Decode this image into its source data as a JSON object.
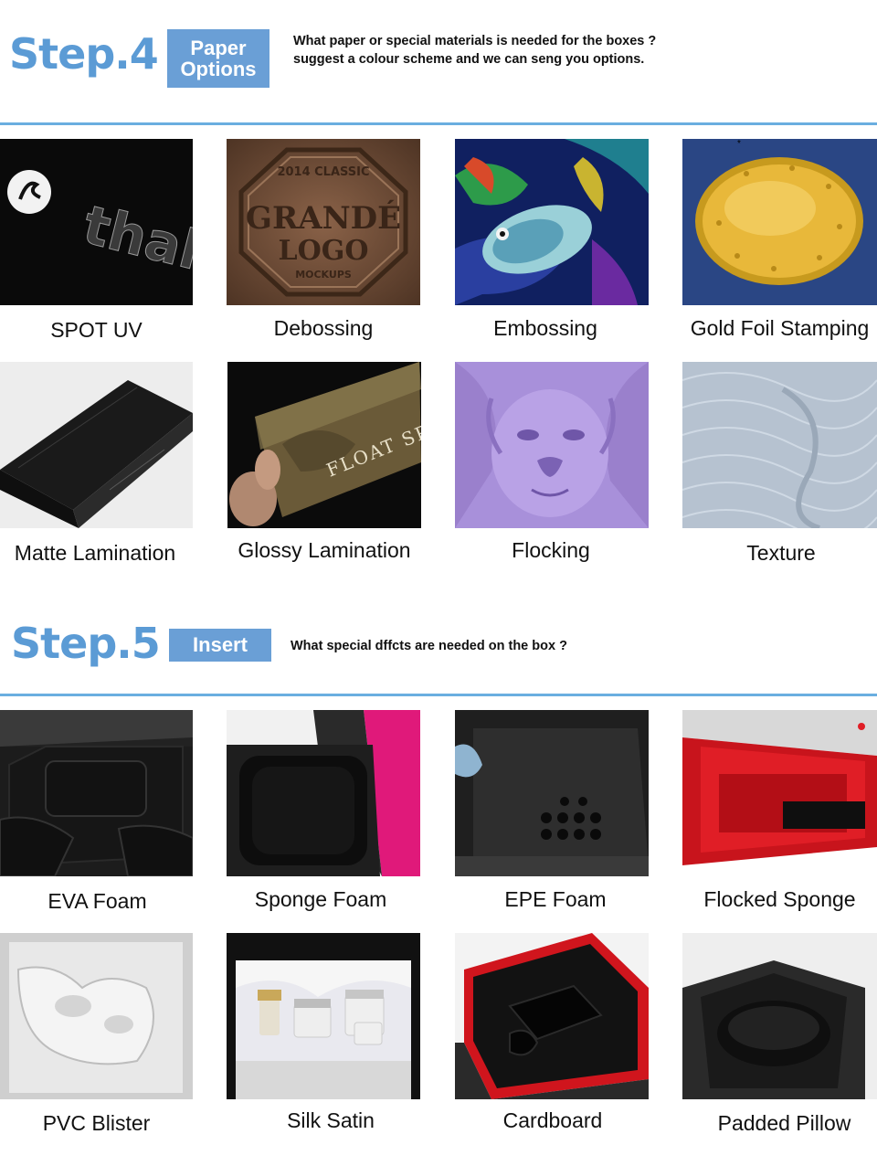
{
  "step4": {
    "title": "Step.4",
    "badge_line1": "Paper",
    "badge_line2": "Options",
    "description": "What paper or special materials is needed for the boxes ? suggest a colour scheme and we can seng you options.",
    "items": [
      {
        "label": "SPOT UV",
        "image": "spot-uv-image"
      },
      {
        "label": "Debossing",
        "image": "debossing-image"
      },
      {
        "label": "Embossing",
        "image": "embossing-image"
      },
      {
        "label": "Gold Foil Stamping",
        "image": "gold-foil-image"
      },
      {
        "label": "Matte Lamination",
        "image": "matte-lamination-image"
      },
      {
        "label": "Glossy Lamination",
        "image": "glossy-lamination-image"
      },
      {
        "label": "Flocking",
        "image": "flocking-image"
      },
      {
        "label": "Texture",
        "image": "texture-image"
      }
    ],
    "image_text": {
      "thalia": "thali",
      "deboss_top": "2014 CLASSIC",
      "deboss_line1": "GRANDÉ",
      "deboss_line2": "LOGO",
      "deboss_bottom": "MOCKUPS",
      "float_spa": "FLOAT SPA"
    }
  },
  "step5": {
    "title": "Step.5",
    "badge": "Insert",
    "description": "What special dffcts are needed on the box ?",
    "items": [
      {
        "label": "EVA Foam",
        "image": "eva-foam-image"
      },
      {
        "label": "Sponge Foam",
        "image": "sponge-foam-image"
      },
      {
        "label": "EPE Foam",
        "image": "epe-foam-image"
      },
      {
        "label": "Flocked Sponge",
        "image": "flocked-sponge-image"
      },
      {
        "label": "PVC Blister",
        "image": "pvc-blister-image"
      },
      {
        "label": "Silk Satin",
        "image": "silk-satin-image"
      },
      {
        "label": "Cardboard",
        "image": "cardboard-image"
      },
      {
        "label": "Padded Pillow",
        "image": "padded-pillow-image"
      }
    ]
  },
  "colors": {
    "accent": "#5b9bd5",
    "badge": "#6a9fd6",
    "rule": "#6aaee0"
  }
}
